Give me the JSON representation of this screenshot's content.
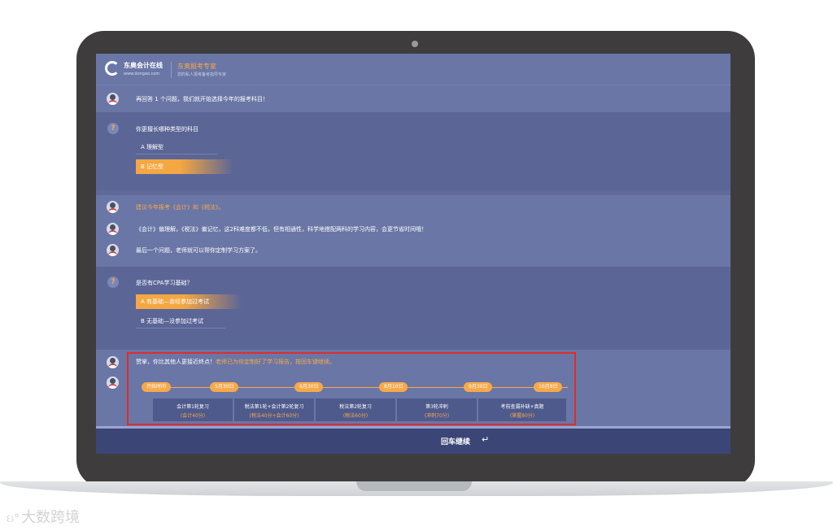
{
  "brand": {
    "name": "东奥会计在线",
    "url": "www.dongao.com",
    "title": "东奥报考专家",
    "subtitle": "您的私人报考备考指导专家"
  },
  "chat": {
    "intro": "再回答 1 个问题，我们就开始选择今年的报考科目！",
    "q1": {
      "question": "你更擅长哪种类型的科目",
      "options": [
        "A 理解型",
        "B 记忆型"
      ],
      "selected_index": 1
    },
    "advice": {
      "line1": "建议今年报考《会计》和《税法》。",
      "line2": "《会计》偏理解，《税法》偏记忆，这2科难度都不低，但有相通性，科学地搭配两科的学习内容，会更节省时间哦！",
      "line3": "最后一个问题，老师就可以帮你定制学习方案了。"
    },
    "q2": {
      "question": "是否有CPA学习基础？",
      "options": [
        "A 有基础—曾经参加过考试",
        "B 无基础—没参加过考试"
      ],
      "selected_index": 0
    },
    "result": {
      "text": "赞掌，你比其他人更接近终点！",
      "highlight": "老师已为你定制好了学习报告，按回车键继续。"
    }
  },
  "timeline": {
    "milestones": [
      "开始时间",
      "5月30日",
      "6月30日",
      "8月10日",
      "9月30日",
      "10月9日"
    ],
    "phases": [
      {
        "title": "会计第1轮复习",
        "score": "(会计40分)"
      },
      {
        "title": "税法第1轮+会计第2轮复习",
        "score": "(税法40分+会计60分)"
      },
      {
        "title": "税法第2轮复习",
        "score": "(税法60分)"
      },
      {
        "title": "第3轮冲刺",
        "score": "(冲刺70分)"
      },
      {
        "title": "考前查漏补缺+真题",
        "score": "(掌握80分)"
      }
    ]
  },
  "footer": {
    "continue_label": "回车继续",
    "enter_icon": "↵"
  },
  "watermark": "大数跨境",
  "colors": {
    "accent": "#f6a94b",
    "panel": "#5f6a99",
    "footer": "#3b4677",
    "highlight_border": "#e02c2c"
  }
}
